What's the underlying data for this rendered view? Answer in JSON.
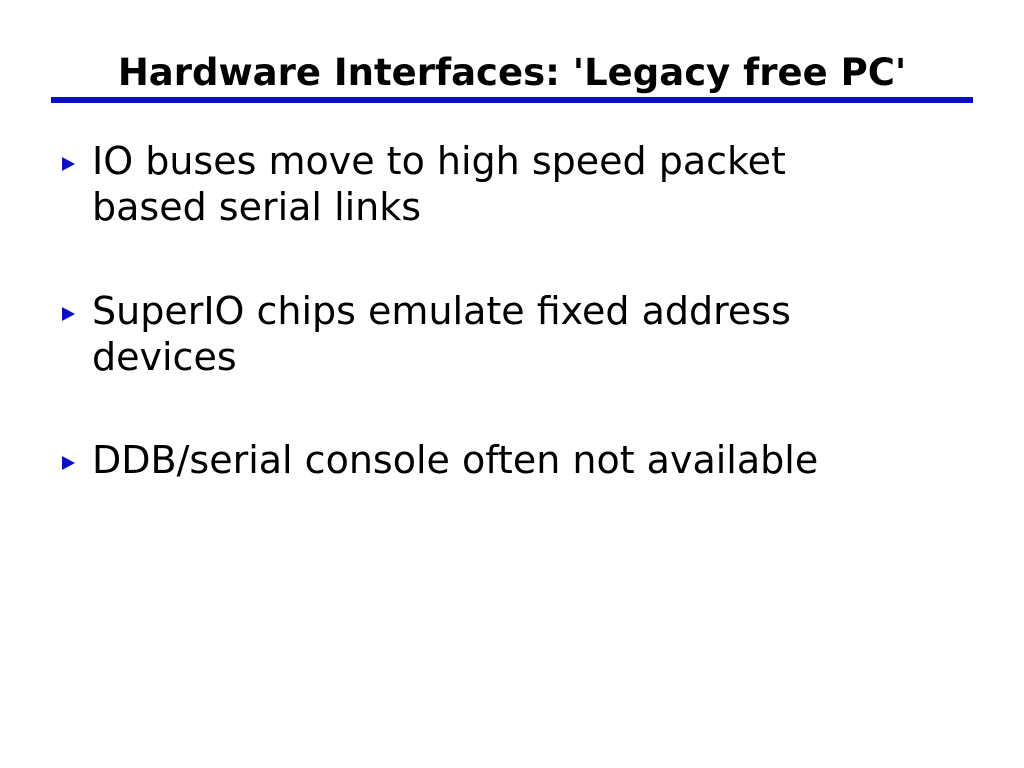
{
  "slide": {
    "title": "Hardware Interfaces: 'Legacy free PC'",
    "accent_color": "#0b10c4",
    "bullet_icon": "triangle-right-icon",
    "bullets": [
      {
        "text": "IO buses move to high speed packet\nbased serial links"
      },
      {
        "text": "SuperIO chips emulate fixed address\ndevices"
      },
      {
        "text": "DDB/serial console often not available"
      }
    ]
  }
}
